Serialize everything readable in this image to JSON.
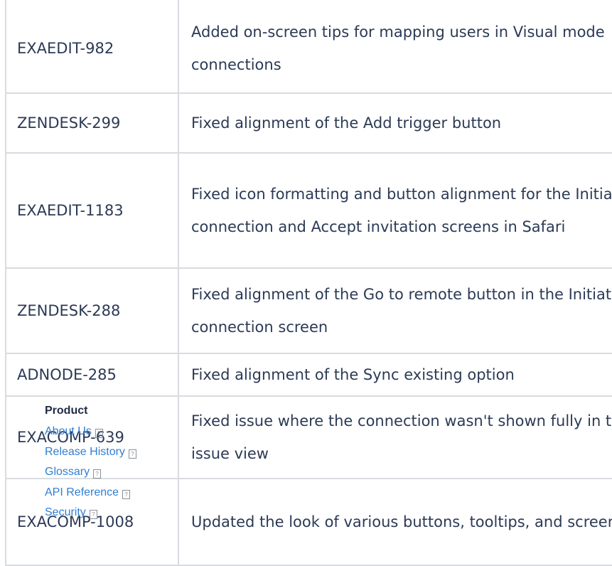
{
  "release_table": {
    "rows": [
      {
        "key": "EXAEDIT-982",
        "description": "Added on-screen tips for mapping users in Visual mode connections"
      },
      {
        "key": "ZENDESK-299",
        "description": "Fixed alignment of the Add trigger button"
      },
      {
        "key": "EXAEDIT-1183",
        "description": "Fixed icon formatting and button alignment for the Initiate connection and Accept invitation screens in Safari"
      },
      {
        "key": "ZENDESK-288",
        "description": "Fixed alignment of the Go to remote button in the Initiate connection screen"
      },
      {
        "key": "ADNODE-285",
        "description": "Fixed alignment of the Sync existing option"
      },
      {
        "key": "EXACOMP-639",
        "description": "Fixed issue where the connection wasn't shown fully in the issue view"
      },
      {
        "key": "EXACOMP-1008",
        "description": "Updated the look of various buttons, tooltips, and screens"
      }
    ]
  },
  "footer": {
    "heading": "Product",
    "links": [
      {
        "label": "About Us",
        "icon": "external-link-icon"
      },
      {
        "label": "Release History",
        "icon": "external-link-icon"
      },
      {
        "label": "Glossary",
        "icon": "external-link-icon"
      },
      {
        "label": "API Reference",
        "icon": "external-link-icon"
      },
      {
        "label": "Security",
        "icon": "external-link-icon"
      }
    ]
  },
  "colors": {
    "text": "#2c3a55",
    "border": "#d9dbe0",
    "link": "#2f7fd4"
  }
}
